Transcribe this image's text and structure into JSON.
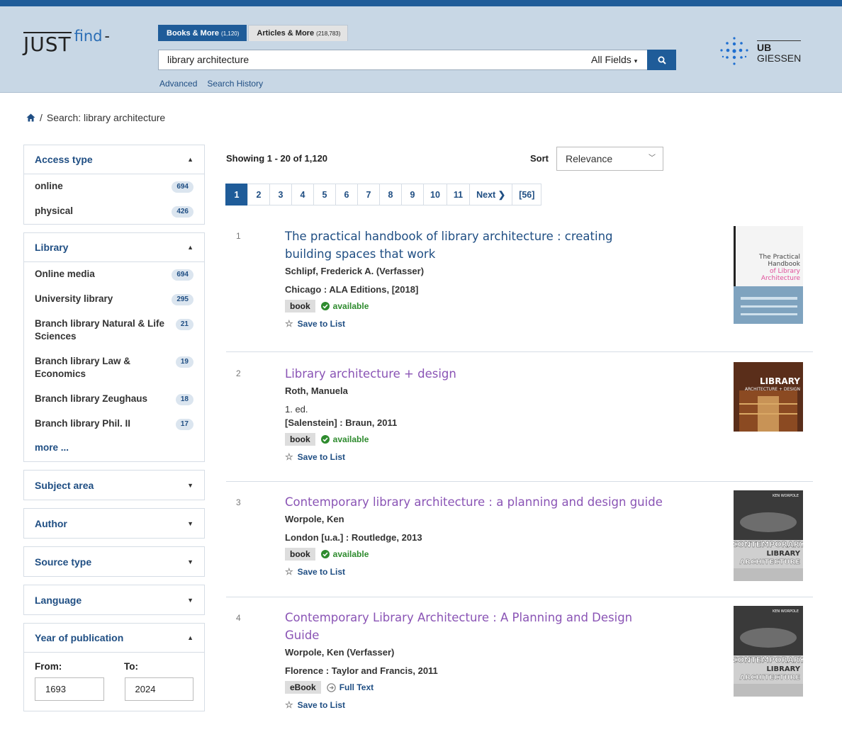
{
  "header": {
    "logo_just": "JUST",
    "logo_find": "find",
    "logo_dash": "-",
    "tabs": [
      {
        "label": "Books & More",
        "count": "(1,120)"
      },
      {
        "label": "Articles & More",
        "count": "(218,783)"
      }
    ],
    "search_value": "library architecture",
    "search_field": "All Fields",
    "links": {
      "advanced": "Advanced",
      "history": "Search History"
    },
    "ub_line1": "UB",
    "ub_line2": "GIESSEN"
  },
  "breadcrumb": {
    "sep": "/",
    "current": "Search: library architecture"
  },
  "sidebar": {
    "access": {
      "title": "Access type",
      "items": [
        {
          "label": "online",
          "count": "694"
        },
        {
          "label": "physical",
          "count": "426"
        }
      ]
    },
    "library": {
      "title": "Library",
      "items": [
        {
          "label": "Online media",
          "count": "694"
        },
        {
          "label": "University library",
          "count": "295"
        },
        {
          "label": "Branch library Natural & Life Sciences",
          "count": "21"
        },
        {
          "label": "Branch library Law & Economics",
          "count": "19"
        },
        {
          "label": "Branch library Zeughaus",
          "count": "18"
        },
        {
          "label": "Branch library Phil. II",
          "count": "17"
        }
      ],
      "more": "more ..."
    },
    "collapsed": [
      "Subject area",
      "Author",
      "Source type",
      "Language"
    ],
    "year": {
      "title": "Year of publication",
      "from_label": "From:",
      "to_label": "To:",
      "from": "1693",
      "to": "2024"
    }
  },
  "results": {
    "showing": "Showing 1 - 20 of 1,120",
    "sort_label": "Sort",
    "sort_value": "Relevance",
    "pages": [
      "1",
      "2",
      "3",
      "4",
      "5",
      "6",
      "7",
      "8",
      "9",
      "10",
      "11"
    ],
    "next": "Next",
    "last": "[56]",
    "items": [
      {
        "num": "1",
        "title": "The practical handbook of library architecture : creating building spaces that work",
        "author": "Schlipf, Frederick A. (Verfasser)",
        "edition": "",
        "pub": "Chicago : ALA Editions, [2018]",
        "format": "book",
        "status": "available",
        "save": "Save to List",
        "cover_lines": [
          "The Practical",
          "Handbook",
          "of Library",
          "Architecture"
        ]
      },
      {
        "num": "2",
        "title": "Library architecture + design",
        "author": "Roth, Manuela",
        "edition": "1. ed.",
        "pub": "[Salenstein] : Braun, 2011",
        "format": "book",
        "status": "available",
        "save": "Save to List",
        "cover_lines": [
          "LIBRARY",
          "ARCHITECTURE + DESIGN"
        ]
      },
      {
        "num": "3",
        "title": "Contemporary library architecture : a planning and design guide",
        "author": "Worpole, Ken",
        "edition": "",
        "pub": "London [u.a.] : Routledge, 2013",
        "format": "book",
        "status": "available",
        "save": "Save to List",
        "cover_lines": [
          "KEN WORPOLE",
          "CONTEMPORARY",
          "LIBRARY",
          "ARCHITECTURE"
        ]
      },
      {
        "num": "4",
        "title": "Contemporary Library Architecture : A Planning and Design Guide",
        "author": "Worpole, Ken (Verfasser)",
        "edition": "",
        "pub": "Florence : Taylor and Francis, 2011",
        "format": "eBook",
        "status": "Full Text",
        "save": "Save to List",
        "cover_lines": [
          "KEN WORPOLE",
          "CONTEMPORARY",
          "LIBRARY",
          "ARCHITECTURE"
        ]
      }
    ]
  }
}
